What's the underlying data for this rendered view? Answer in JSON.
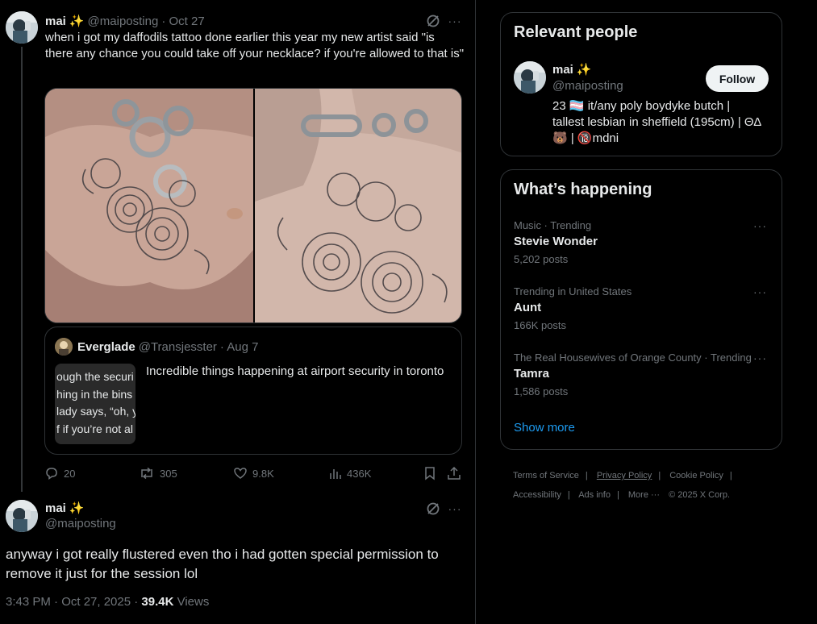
{
  "tweet1": {
    "name": "mai",
    "emoji": "✨",
    "handle": "@maiposting",
    "date": "· Oct 27",
    "text": "when i got my daffodils tattoo done earlier this year my new artist said \"is there any chance you could take off your necklace? if you're allowed to that is\""
  },
  "quote": {
    "name": "Everglade",
    "handle": "@Transjesster",
    "date": "· Aug 7",
    "text": "Incredible things happening at airport security in toronto",
    "thumb_lines": [
      "ough the securi",
      "hing in the bins",
      "lady says, “oh, y",
      "f if you’re not al"
    ]
  },
  "actions": {
    "replies": "20",
    "reposts": "305",
    "likes": "9.8K",
    "views": "436K"
  },
  "tweet2": {
    "name": "mai",
    "emoji": "✨",
    "handle": "@maiposting",
    "text": "anyway i got really flustered even tho i had gotten special permission to remove it just for the session lol",
    "timestamp": "3:43 PM · Oct 27, 2025 · ",
    "views_count": "39.4K",
    "views_label": " Views"
  },
  "relevant": {
    "title": "Relevant people",
    "name": "mai",
    "emoji": "✨",
    "handle": "@maiposting",
    "follow_label": "Follow",
    "bio_line1": "23 🏳️‍⚧️ it/any poly boydyke butch |",
    "bio_line2": "tallest lesbian in sheffield (195cm) | ΘΔ",
    "bio_line3": "🐻 | 🔞mdni"
  },
  "happening": {
    "title": "What’s happening",
    "trends": [
      {
        "context": "Music · Trending",
        "topic": "Stevie Wonder",
        "count": "5,202 posts"
      },
      {
        "context": "Trending in United States",
        "topic": "Aunt",
        "count": "166K posts"
      },
      {
        "context": "The Real Housewives of Orange County · Trending",
        "topic": "Tamra",
        "count": "1,586 posts"
      }
    ],
    "show_more": "Show more"
  },
  "footer": {
    "terms": "Terms of Service",
    "privacy": "Privacy Policy",
    "cookie": "Cookie Policy",
    "accessibility": "Accessibility",
    "ads": "Ads info",
    "more": "More ···",
    "copyright": "© 2025 X Corp."
  },
  "colors": {
    "background": "#000000",
    "text": "#e7e9ea",
    "muted": "#71767b",
    "link": "#1d9bf0",
    "border": "#2f3336"
  }
}
